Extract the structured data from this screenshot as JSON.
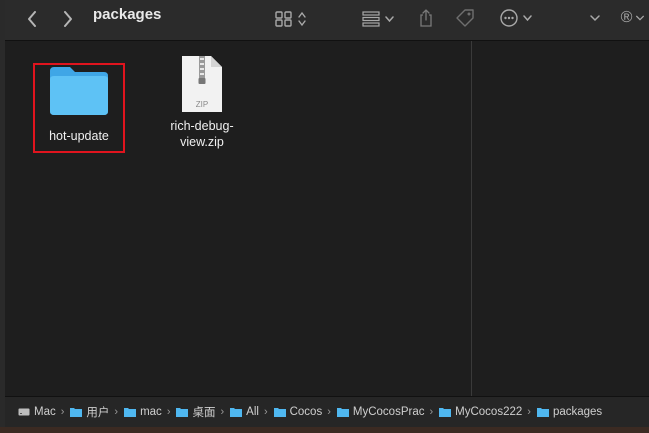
{
  "window": {
    "title": "packages"
  },
  "toolbar": {
    "back_icon": "chevron-left",
    "forward_icon": "chevron-right",
    "view_icon": "grid-view",
    "group_icon": "group-by",
    "share_icon": "share",
    "tag_icon": "tag",
    "more_icon": "ellipsis-circle",
    "extension_label": "®"
  },
  "files": [
    {
      "name": "hot-update",
      "type": "folder",
      "selected": true
    },
    {
      "name": "rich-debug-view.zip",
      "name_line1": "rich-debug-",
      "name_line2": "view.zip",
      "type": "zip",
      "badge": "ZIP"
    }
  ],
  "pathbar": {
    "items": [
      "Mac",
      "用户",
      "mac",
      "桌面",
      "All",
      "Cocos",
      "MyCocosPrac",
      "MyCocos222",
      "packages"
    ]
  },
  "colors": {
    "folder": "#4fb7f0",
    "selection": "#e0141e",
    "background": "#1e1e1e"
  }
}
